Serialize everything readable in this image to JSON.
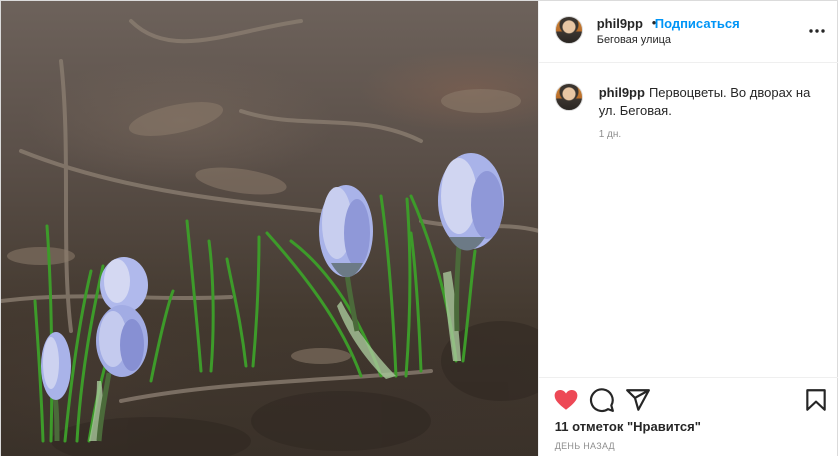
{
  "post": {
    "author": "phil9pp",
    "location": "Беговая улица",
    "follow_label": "Подписаться",
    "separator": "•",
    "caption_author": "phil9pp",
    "caption_text": "Первоцветы. Во дворах на ул. Беговая.",
    "caption_time": "1 дн.",
    "likes_text": "11 отметок \"Нравится\"",
    "posted_ago": "ДЕНЬ НАЗАД"
  },
  "icons": {
    "more": "more-options-icon",
    "like": "heart-icon",
    "comment": "comment-icon",
    "share": "share-icon",
    "save": "bookmark-icon"
  },
  "colors": {
    "accent": "#0095f6",
    "liked": "#ed4956",
    "text": "#262626",
    "muted": "#8e8e8e",
    "border": "#dbdbdb"
  }
}
